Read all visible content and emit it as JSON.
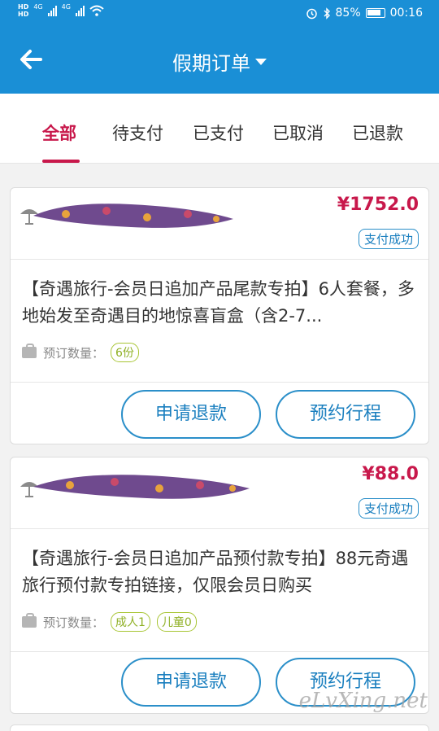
{
  "status_bar": {
    "hd1": "HD",
    "hd2": "HD",
    "net1": "4G",
    "net2": "4G",
    "battery_percent": "85%",
    "time": "00:16"
  },
  "header": {
    "title": "假期订单"
  },
  "tabs": [
    {
      "label": "全部",
      "active": true
    },
    {
      "label": "待支付",
      "active": false
    },
    {
      "label": "已支付",
      "active": false
    },
    {
      "label": "已取消",
      "active": false
    },
    {
      "label": "已退款",
      "active": false
    }
  ],
  "orders": [
    {
      "price": "¥1752.0",
      "status": "支付成功",
      "title": "【奇遇旅行-会员日追加产品尾款专拍】6人套餐，多地始发至奇遇目的地惊喜盲盒（含2-7...",
      "qty_label": "预订数量：",
      "qty_badges": [
        "6份"
      ],
      "buttons": [
        "申请退款",
        "预约行程"
      ]
    },
    {
      "price": "¥88.0",
      "status": "支付成功",
      "title": "【奇遇旅行-会员日追加产品预付款专拍】88元奇遇旅行预付款专拍链接，仅限会员日购买",
      "qty_label": "预订数量：",
      "qty_badges": [
        "成人1",
        "儿童0"
      ],
      "buttons": [
        "申请退款",
        "预约行程"
      ]
    }
  ],
  "watermark": "eLvXing.net",
  "colors": {
    "brand_blue": "#1a8fd6",
    "accent_red": "#c8184b",
    "qty_green": "#a8c534"
  },
  "icons": {
    "back": "arrow-left-icon",
    "dropdown": "caret-down-icon",
    "order_thumb": "beach-umbrella-icon",
    "qty": "bag-icon"
  }
}
